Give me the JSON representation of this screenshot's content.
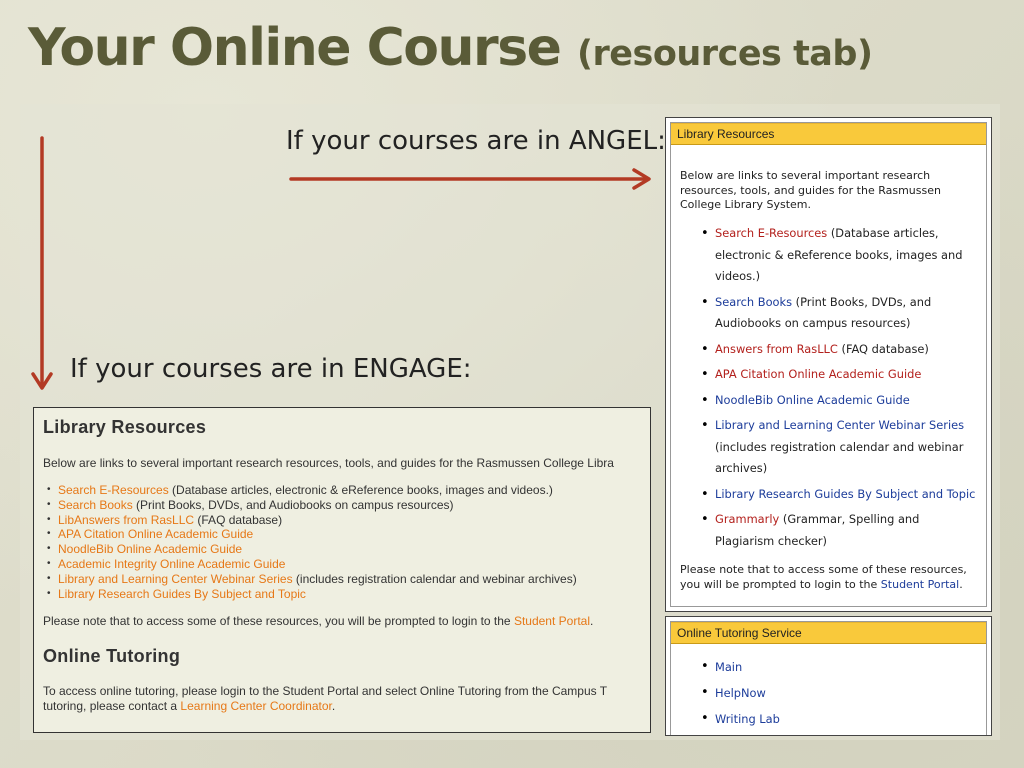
{
  "slide": {
    "title": "Your Online Course",
    "title_sub": "(resources tab)",
    "caption_angel": "If your courses are in ANGEL:",
    "caption_engage": "If your courses are in ENGAGE:",
    "colors": {
      "title": "#5a5b38",
      "arrow": "#b33a24",
      "engage_link": "#e67817",
      "angel_header": "#f9c93b"
    }
  },
  "engage": {
    "heading": "Library Resources",
    "intro": "Below are links to several important research resources, tools, and guides for the Rasmussen College Libra",
    "items": [
      {
        "link": "Search E-Resources",
        "rest": " (Database articles, electronic & eReference books, images and videos.)"
      },
      {
        "link": "Search Books",
        "rest": " (Print Books, DVDs, and Audiobooks on campus resources)"
      },
      {
        "link": "LibAnswers from RasLLC",
        "rest": " (FAQ database)"
      },
      {
        "link": "APA Citation Online Academic Guide",
        "rest": ""
      },
      {
        "link": "NoodleBib Online Academic Guide",
        "rest": ""
      },
      {
        "link": "Academic Integrity Online Academic Guide",
        "rest": ""
      },
      {
        "link": "Library and Learning Center Webinar Series",
        "rest": " (includes registration calendar and webinar archives)"
      },
      {
        "link": "Library Research Guides By Subject and Topic",
        "rest": ""
      }
    ],
    "note_text": "Please note that to access some of these resources, you will be prompted to login to the ",
    "note_link": "Student Portal",
    "note_end": ".",
    "tutoring_heading": "Online Tutoring",
    "tutoring_line1": "To access online tutoring, please login to the Student Portal and select Online Tutoring from the Campus T",
    "tutoring_line2": "tutoring, please contact a ",
    "tutoring_link": "Learning Center Coordinator",
    "tutoring_end": "."
  },
  "angel": {
    "library_header": "Library Resources",
    "intro": "Below are links to several important research resources, tools, and guides for the Rasmussen College Library System.",
    "items": [
      {
        "link": "Search E-Resources",
        "rest": " (Database articles, electronic & eReference books, images and videos.)",
        "color": "red"
      },
      {
        "link": "Search Books",
        "rest": " (Print Books, DVDs, and Audiobooks on campus resources)",
        "color": "blue"
      },
      {
        "link": "Answers from RasLLC",
        "rest": " (FAQ database)",
        "color": "red"
      },
      {
        "link": "APA Citation Online Academic Guide",
        "rest": "",
        "color": "red"
      },
      {
        "link": "NoodleBib Online Academic Guide",
        "rest": "",
        "color": "blue"
      },
      {
        "link": "Library and Learning Center Webinar Series",
        "rest": " (includes registration calendar and webinar archives)",
        "color": "blue"
      },
      {
        "link": "Library Research Guides By Subject and Topic",
        "rest": "",
        "color": "blue"
      },
      {
        "link": "Grammarly",
        "rest": " (Grammar, Spelling and Plagiarism checker)",
        "color": "red"
      }
    ],
    "note_text": "Please note that to access some of these resources, you will be prompted to login to the ",
    "note_link": "Student Portal",
    "note_end": ".",
    "tutoring_header": "Online Tutoring Service",
    "tutoring_items": [
      "Main",
      "HelpNow",
      "Writing Lab"
    ]
  }
}
